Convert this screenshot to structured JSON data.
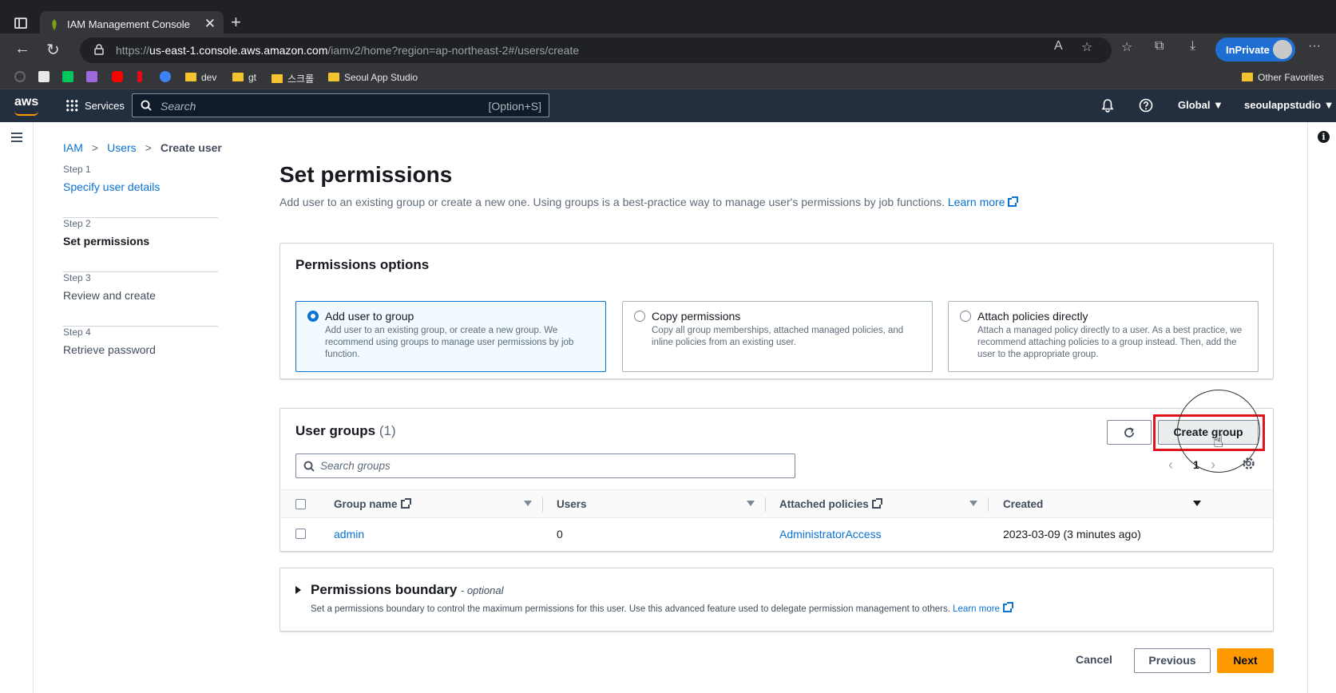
{
  "browser": {
    "tab_title": "IAM Management Console",
    "tab_close": "✕",
    "new_tab": "+",
    "url_host_prefix": "https://",
    "url_host": "us-east-1.console.aws.amazon.com",
    "url_path": "/iamv2/home?region=ap-northeast-2#/users/create",
    "inprivate_label": "InPrivate",
    "bookmarks": [
      "dev",
      "gt",
      "스크롤",
      "Seoul App Studio"
    ],
    "other_favorites": "Other Favorites"
  },
  "aws_nav": {
    "logo": "aws",
    "services_label": "Services",
    "search_placeholder": "Search",
    "search_shortcut": "[Option+S]",
    "region": "Global ▼",
    "account": "seoulappstudio ▼"
  },
  "breadcrumb": {
    "iam": "IAM",
    "users": "Users",
    "current": "Create user",
    "sep": ">"
  },
  "steps": [
    {
      "num": "Step 1",
      "title": "Specify user details"
    },
    {
      "num": "Step 2",
      "title": "Set permissions"
    },
    {
      "num": "Step 3",
      "title": "Review and create"
    },
    {
      "num": "Step 4",
      "title": "Retrieve password"
    }
  ],
  "page": {
    "title": "Set permissions",
    "description": "Add user to an existing group or create a new one. Using groups is a best-practice way to manage user's permissions by job functions.",
    "learn_more": "Learn more"
  },
  "permissions_options": {
    "title": "Permissions options",
    "tiles": [
      {
        "title": "Add user to group",
        "desc": "Add user to an existing group, or create a new group. We recommend using groups to manage user permissions by job function."
      },
      {
        "title": "Copy permissions",
        "desc": "Copy all group memberships, attached managed policies, and inline policies from an existing user."
      },
      {
        "title": "Attach policies directly",
        "desc": "Attach a managed policy directly to a user. As a best practice, we recommend attaching policies to a group instead. Then, add the user to the appropriate group."
      }
    ]
  },
  "user_groups": {
    "title": "User groups",
    "count": "(1)",
    "create_group_label": "Create group",
    "search_placeholder": "Search groups",
    "page_prev": "‹",
    "page_number": "1",
    "page_next": "›",
    "columns": {
      "group_name": "Group name",
      "users": "Users",
      "attached_policies": "Attached policies",
      "created": "Created"
    },
    "rows": [
      {
        "group_name": "admin",
        "users": "0",
        "attached_policies": "AdministratorAccess",
        "created": "2023-03-09 (3 minutes ago)"
      }
    ]
  },
  "boundary": {
    "title": "Permissions boundary",
    "optional": "- optional",
    "description": "Set a permissions boundary to control the maximum permissions for this user. Use this advanced feature used to delegate permission management to others.",
    "learn_more": "Learn more"
  },
  "footer": {
    "cancel": "Cancel",
    "previous": "Previous",
    "next": "Next"
  }
}
